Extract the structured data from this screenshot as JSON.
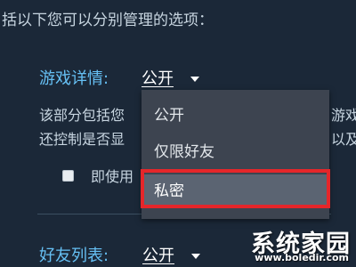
{
  "intro_text": "括以下您可以分别管理的选项：",
  "game_details": {
    "label": "游戏详情:",
    "value": "公开",
    "desc_line1": "该部分包括您",
    "desc_line1_tail": "游戏",
    "desc_line2": "还控制是否显",
    "desc_line2_tail": "以及》",
    "checkbox_label": "即使用"
  },
  "dropdown": {
    "items": [
      {
        "label": "公开"
      },
      {
        "label": "仅限好友"
      },
      {
        "label": "私密"
      }
    ],
    "selected_index": 2
  },
  "friends_list": {
    "label": "好友列表:",
    "value": "公开"
  },
  "watermark": {
    "text": "系统家园",
    "url": "www.boledir.com"
  },
  "colors": {
    "background": "#1b2838",
    "accent_label": "#66c0f4",
    "menu_bg": "#3d4450",
    "highlight_border": "#e5262a"
  }
}
